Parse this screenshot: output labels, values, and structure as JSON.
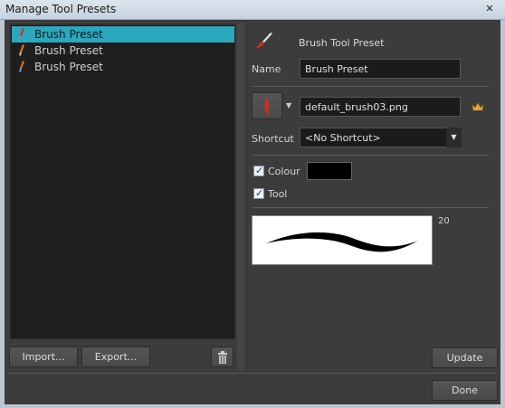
{
  "window": {
    "title": "Manage Tool Presets",
    "close_glyph": "✕"
  },
  "preset_list": {
    "items": [
      {
        "label": "Brush Preset",
        "selected": true,
        "icon": "brush-icon"
      },
      {
        "label": "Brush Preset",
        "selected": false,
        "icon": "brush-icon"
      },
      {
        "label": "Brush Preset",
        "selected": false,
        "icon": "brush-icon"
      }
    ]
  },
  "left_buttons": {
    "import_label": "Import...",
    "export_label": "Export...",
    "delete_icon": "trash-icon"
  },
  "details": {
    "section_title": "Brush Tool Preset",
    "name_label": "Name",
    "name_value": "Brush Preset",
    "brush_file": "default_brush03.png",
    "shortcut_label": "Shortcut",
    "shortcut_value": "<No Shortcut>",
    "colour_label": "Colour",
    "colour_checked": true,
    "colour_value": "#000000",
    "tool_label": "Tool",
    "tool_checked": true,
    "preview_size": "20"
  },
  "buttons": {
    "update_label": "Update",
    "done_label": "Done"
  },
  "colors": {
    "selection": "#2aa8bd",
    "panel_bg": "#3c3c3c",
    "list_bg": "#1e1e1e",
    "accent_red": "#c8322a",
    "crown": "#e8a53a"
  }
}
